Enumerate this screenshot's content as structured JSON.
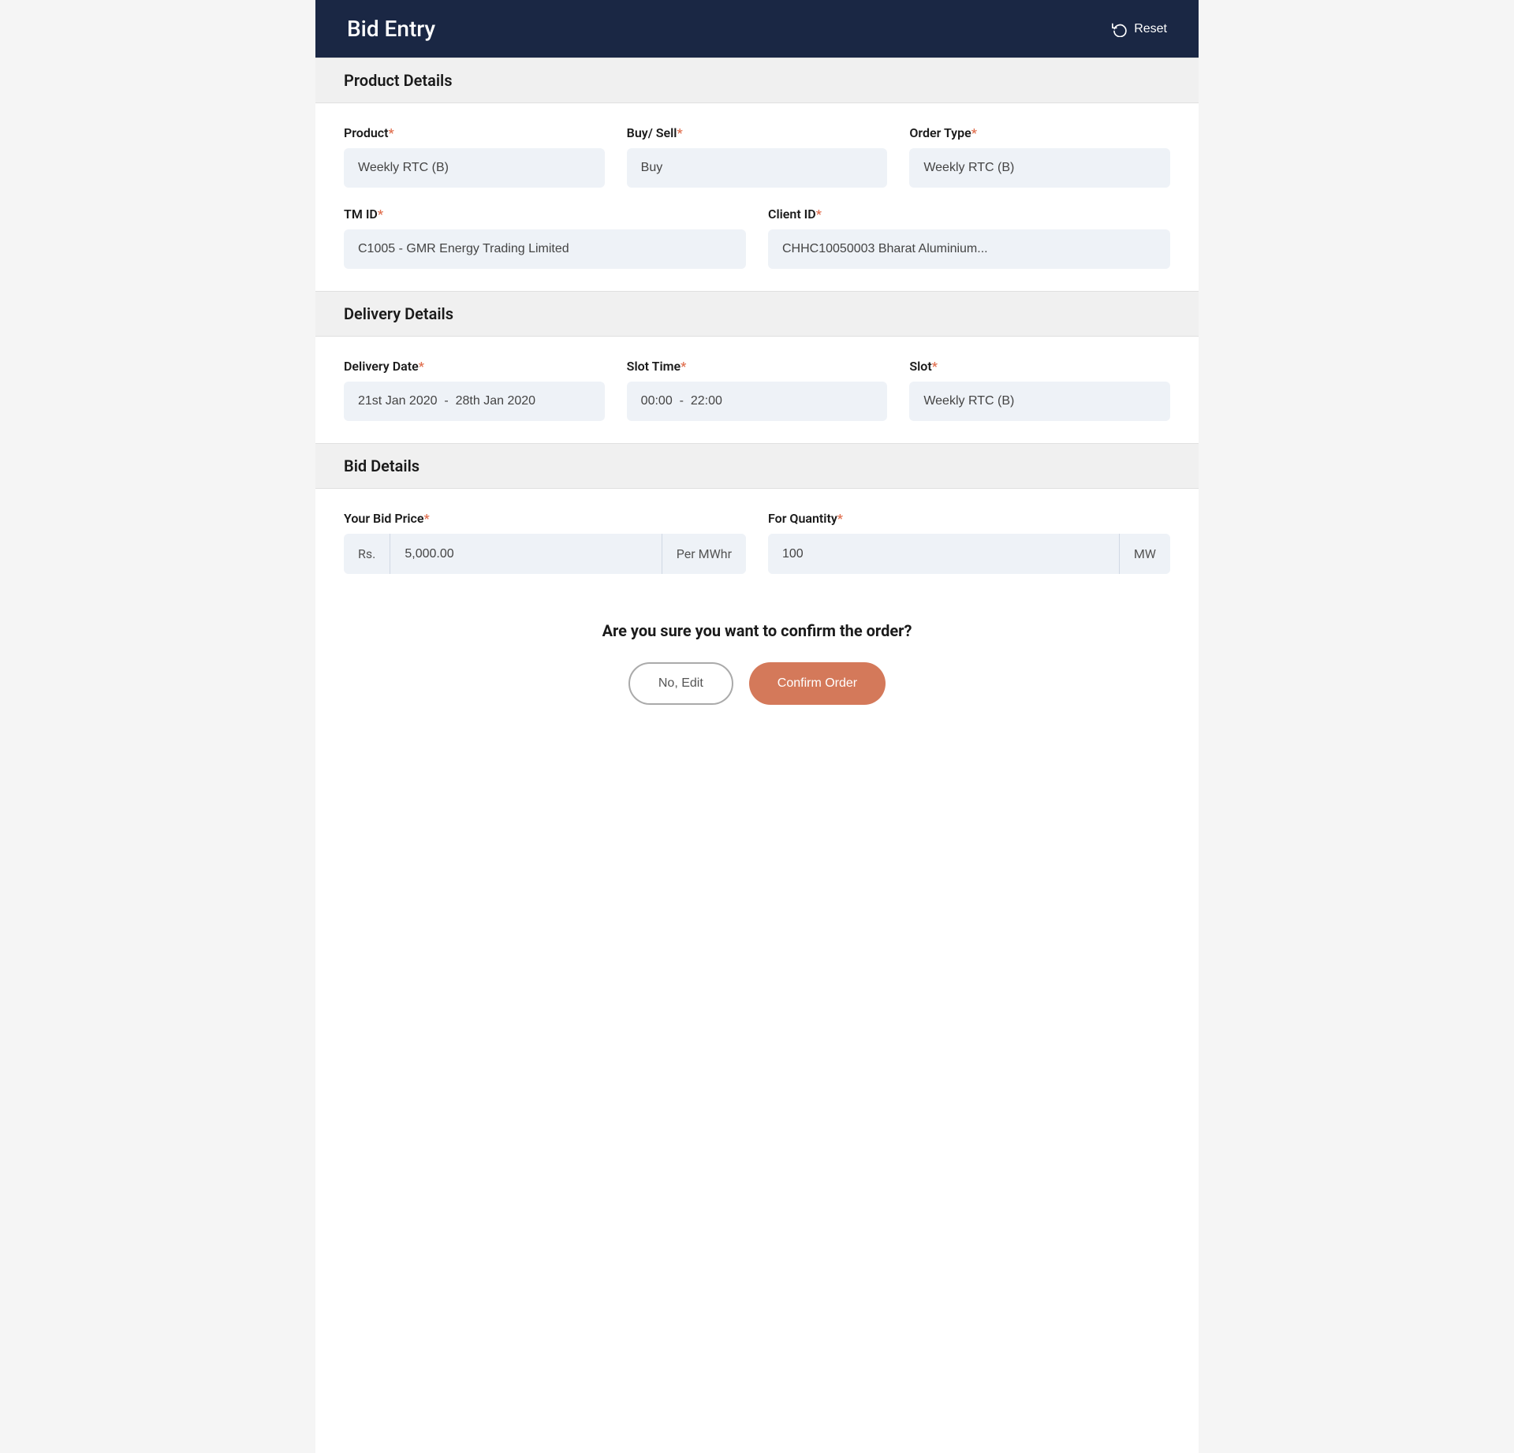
{
  "header": {
    "title": "Bid Entry",
    "reset_label": "Reset"
  },
  "product_details": {
    "section_label": "Product Details",
    "product": {
      "label": "Product",
      "required": true,
      "value": "Weekly RTC (B)"
    },
    "buy_sell": {
      "label": "Buy/ Sell",
      "required": true,
      "value": "Buy"
    },
    "order_type": {
      "label": "Order Type",
      "required": true,
      "value": "Weekly RTC (B)"
    },
    "tm_id": {
      "label": "TM ID",
      "required": true,
      "value": "C1005 - GMR Energy Trading Limited"
    },
    "client_id": {
      "label": "Client ID",
      "required": true,
      "value": "CHHC10050003 Bharat Aluminium..."
    }
  },
  "delivery_details": {
    "section_label": "Delivery Details",
    "delivery_date": {
      "label": "Delivery Date",
      "required": true,
      "value": "21st Jan 2020  -  28th Jan 2020"
    },
    "slot_time": {
      "label": "Slot Time",
      "required": true,
      "value": "00:00  -  22:00"
    },
    "slot": {
      "label": "Slot",
      "required": true,
      "value": "Weekly RTC (B)"
    }
  },
  "bid_details": {
    "section_label": "Bid Details",
    "bid_price": {
      "label": "Your Bid Price",
      "required": true,
      "prefix": "Rs.",
      "value": "5,000.00",
      "suffix": "Per MWhr"
    },
    "quantity": {
      "label": "For Quantity",
      "required": true,
      "value": "100",
      "suffix": "MW"
    }
  },
  "confirmation": {
    "question": "Are you sure you want to confirm the order?",
    "no_edit_label": "No, Edit",
    "confirm_label": "Confirm Order"
  }
}
